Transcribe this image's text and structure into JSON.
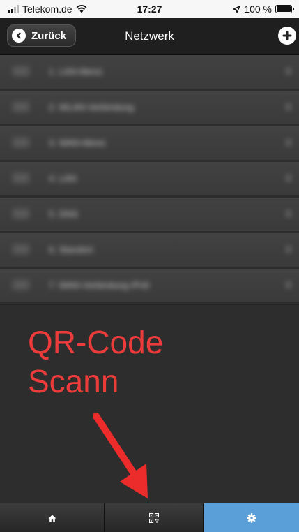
{
  "status_bar": {
    "carrier": "Telekom.de",
    "time": "17:27",
    "battery": "100 %",
    "battery_level": 1.0
  },
  "header": {
    "back_label": "Zurück",
    "title": "Netzwerk"
  },
  "list_items": [
    {
      "label": "1. LAN-Menü"
    },
    {
      "label": "2. WLAN-Verbindung"
    },
    {
      "label": "3. WAN-Menü"
    },
    {
      "label": "4. LAN"
    },
    {
      "label": "5. DNS"
    },
    {
      "label": "6. Standort"
    },
    {
      "label": "7. WAN-Verbindung IPv6"
    }
  ],
  "annotation": {
    "line1": "QR-Code",
    "line2": "Scann"
  },
  "tab_bar": {
    "tabs": [
      {
        "icon": "home-icon"
      },
      {
        "icon": "qr-code-icon"
      },
      {
        "icon": "gear-icon",
        "active": true
      }
    ]
  },
  "colors": {
    "annotation": "#ec3b3b",
    "active_tab": "#5a9fd8",
    "header": "#1f1f1f"
  }
}
